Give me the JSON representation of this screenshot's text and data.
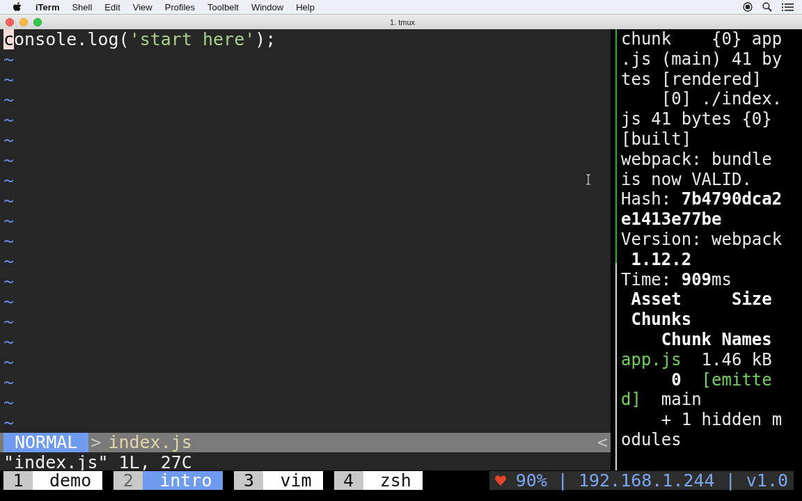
{
  "menubar": {
    "app": "iTerm",
    "menus": [
      "Shell",
      "Edit",
      "View",
      "Profiles",
      "Toolbelt",
      "Window",
      "Help"
    ]
  },
  "window": {
    "title": "1. tmux"
  },
  "editor": {
    "code_line": [
      {
        "text": "c",
        "kind": "cursor"
      },
      {
        "text": "onsole.log(",
        "kind": "plain"
      },
      {
        "text": "'start here'",
        "kind": "string"
      },
      {
        "text": ");",
        "kind": "plain"
      }
    ],
    "empty_lines": [
      "~",
      "~",
      "~",
      "~",
      "~",
      "~",
      "~",
      "~",
      "~",
      "~",
      "~",
      "~",
      "~",
      "~",
      "~",
      "~",
      "~",
      "~",
      "~"
    ],
    "status": {
      "mode": "NORMAL",
      "separator": ">",
      "file": "index.js",
      "right": "<"
    },
    "message": "\"index.js\" 1L, 27C"
  },
  "log": {
    "lines": [
      [
        {
          "text": "chunk    {0} app",
          "kind": "plain"
        }
      ],
      [
        {
          "text": ".js (main) 41 by",
          "kind": "plain"
        }
      ],
      [
        {
          "text": "tes [rendered]",
          "kind": "plain"
        }
      ],
      [
        {
          "text": "    [0] ./index.",
          "kind": "plain"
        }
      ],
      [
        {
          "text": "js 41 bytes {0}",
          "kind": "plain"
        }
      ],
      [
        {
          "text": "[built]",
          "kind": "plain"
        }
      ],
      [
        {
          "text": "webpack: bundle",
          "kind": "plain"
        }
      ],
      [
        {
          "text": "is now VALID.",
          "kind": "plain"
        }
      ],
      [
        {
          "text": "Hash: ",
          "kind": "plain"
        },
        {
          "text": "7b4790dca2",
          "kind": "bold"
        }
      ],
      [
        {
          "text": "e1413e77be",
          "kind": "bold"
        }
      ],
      [
        {
          "text": "Version: webpack",
          "kind": "plain"
        }
      ],
      [
        {
          "text": " 1.12.2",
          "kind": "bold"
        }
      ],
      [
        {
          "text": "Time: ",
          "kind": "plain"
        },
        {
          "text": "909",
          "kind": "bold"
        },
        {
          "text": "ms",
          "kind": "plain"
        }
      ],
      [
        {
          "text": " Asset     Size",
          "kind": "bold"
        }
      ],
      [
        {
          "text": " Chunks",
          "kind": "bold"
        }
      ],
      [
        {
          "text": "    Chunk Names",
          "kind": "bold"
        }
      ],
      [
        {
          "text": "app.js",
          "kind": "green"
        },
        {
          "text": "  1.46 kB",
          "kind": "plain"
        }
      ],
      [
        {
          "text": "     0",
          "kind": "bold"
        },
        {
          "text": "  [emitte",
          "kind": "green"
        }
      ],
      [
        {
          "text": "d]",
          "kind": "green"
        },
        {
          "text": "  main",
          "kind": "plain"
        }
      ],
      [
        {
          "text": "    + 1 hidden m",
          "kind": "plain"
        }
      ],
      [
        {
          "text": "odules",
          "kind": "plain"
        }
      ]
    ]
  },
  "tmux": {
    "windows": [
      {
        "index": "1",
        "name": "demo",
        "selected": false
      },
      {
        "index": "2",
        "name": "intro",
        "selected": true
      },
      {
        "index": "3",
        "name": "vim",
        "selected": false
      },
      {
        "index": "4",
        "name": "zsh",
        "selected": false
      }
    ],
    "status_right": "90% | 192.168.1.244 | v1.0"
  }
}
